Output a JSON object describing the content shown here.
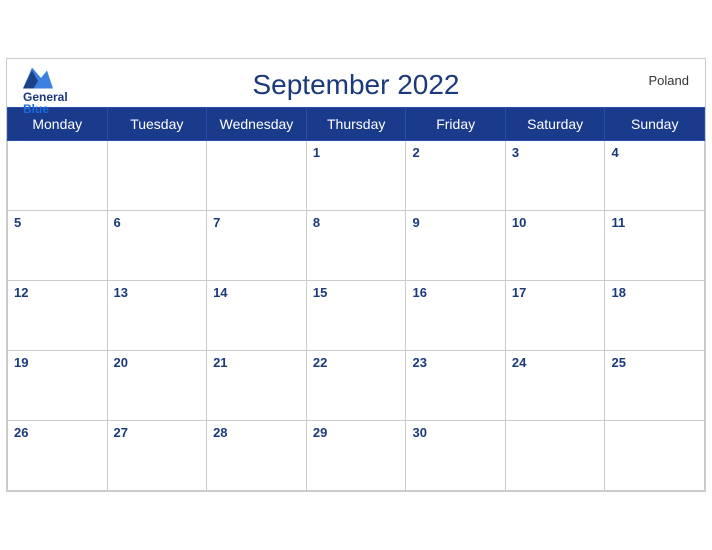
{
  "header": {
    "title": "September 2022",
    "country": "Poland",
    "logo_general": "General",
    "logo_blue": "Blue"
  },
  "weekdays": [
    "Monday",
    "Tuesday",
    "Wednesday",
    "Thursday",
    "Friday",
    "Saturday",
    "Sunday"
  ],
  "weeks": [
    [
      null,
      null,
      null,
      1,
      2,
      3,
      4
    ],
    [
      5,
      6,
      7,
      8,
      9,
      10,
      11
    ],
    [
      12,
      13,
      14,
      15,
      16,
      17,
      18
    ],
    [
      19,
      20,
      21,
      22,
      23,
      24,
      25
    ],
    [
      26,
      27,
      28,
      29,
      30,
      null,
      null
    ]
  ]
}
